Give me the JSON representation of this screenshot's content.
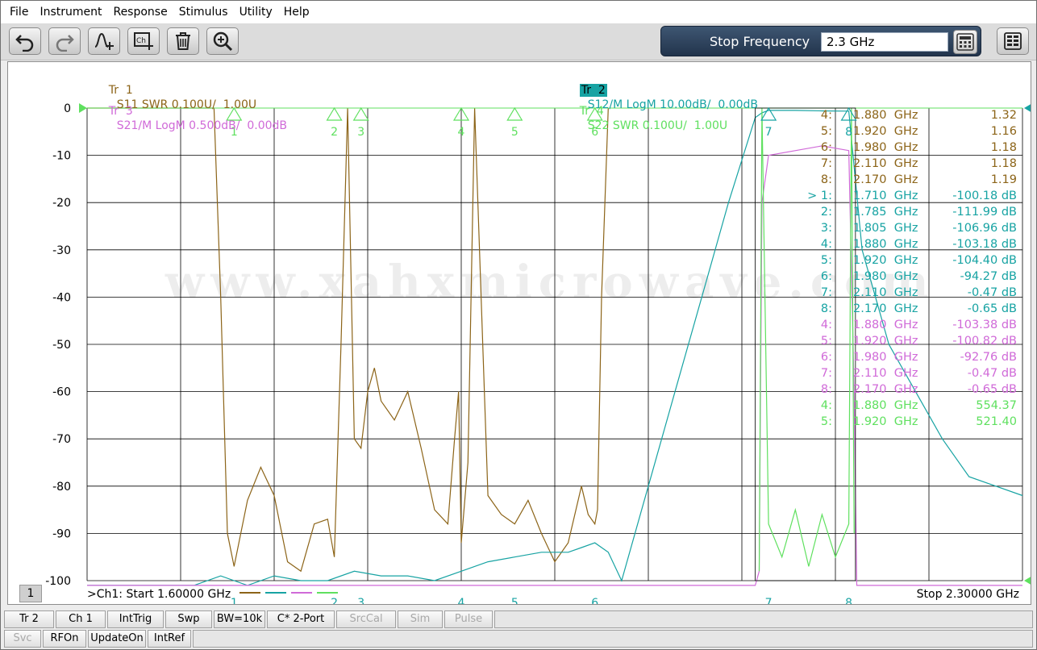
{
  "menu": [
    "File",
    "Instrument",
    "Response",
    "Stimulus",
    "Utility",
    "Help"
  ],
  "toolbar": {
    "icons": [
      "undo-icon",
      "redo-icon",
      "marker-add-icon",
      "channel-add-icon",
      "delete-icon",
      "zoom-icon"
    ],
    "entry_label": "Stop Frequency",
    "entry_value": "2.3 GHz",
    "keypad_icon": "calculator-icon",
    "menu_icon": "hardkey-menu-icon"
  },
  "traces": {
    "tr1": {
      "name": "Tr  1",
      "desc": "S11 SWR 0.100U/  1.00U",
      "color": "#8c6418"
    },
    "tr2": {
      "name": "Tr  2",
      "desc": "S12/M LogM 10.00dB/  0.00dB",
      "color": "#17a3a3"
    },
    "tr3": {
      "name": "Tr  3",
      "desc": "S21/M LogM 0.500dB/  0.00dB",
      "color": "#d06ad8"
    },
    "tr4": {
      "name": "Tr  4",
      "desc": "S22 SWR 0.100U/  1.00U",
      "color": "#5fe05f"
    }
  },
  "y_ticks": [
    "0",
    "-10",
    "-20",
    "-30",
    "-40",
    "-50",
    "-60",
    "-70",
    "-80",
    "-90",
    "-100"
  ],
  "marker_table": [
    {
      "m": "4:",
      "f": "1.880  GHz",
      "v": "1.32",
      "trace": "tr1"
    },
    {
      "m": "5:",
      "f": "1.920  GHz",
      "v": "1.16",
      "trace": "tr1"
    },
    {
      "m": "6:",
      "f": "1.980  GHz",
      "v": "1.18",
      "trace": "tr1"
    },
    {
      "m": "7:",
      "f": "2.110  GHz",
      "v": "1.18",
      "trace": "tr1"
    },
    {
      "m": "8:",
      "f": "2.170  GHz",
      "v": "1.19",
      "trace": "tr1"
    },
    {
      "m": "> 1:",
      "f": "1.710  GHz",
      "v": "-100.18 dB",
      "trace": "tr2"
    },
    {
      "m": "2:",
      "f": "1.785  GHz",
      "v": "-111.99 dB",
      "trace": "tr2"
    },
    {
      "m": "3:",
      "f": "1.805  GHz",
      "v": "-106.96 dB",
      "trace": "tr2"
    },
    {
      "m": "4:",
      "f": "1.880  GHz",
      "v": "-103.18 dB",
      "trace": "tr2"
    },
    {
      "m": "5:",
      "f": "1.920  GHz",
      "v": "-104.40 dB",
      "trace": "tr2"
    },
    {
      "m": "6:",
      "f": "1.980  GHz",
      "v": "-94.27 dB",
      "trace": "tr2"
    },
    {
      "m": "7:",
      "f": "2.110  GHz",
      "v": "-0.47 dB",
      "trace": "tr2"
    },
    {
      "m": "8:",
      "f": "2.170  GHz",
      "v": "-0.65 dB",
      "trace": "tr2"
    },
    {
      "m": "4:",
      "f": "1.880  GHz",
      "v": "-103.38 dB",
      "trace": "tr3"
    },
    {
      "m": "5:",
      "f": "1.920  GHz",
      "v": "-100.82 dB",
      "trace": "tr3"
    },
    {
      "m": "6:",
      "f": "1.980  GHz",
      "v": "-92.76 dB",
      "trace": "tr3"
    },
    {
      "m": "7:",
      "f": "2.110  GHz",
      "v": "-0.47 dB",
      "trace": "tr3"
    },
    {
      "m": "8:",
      "f": "2.170  GHz",
      "v": "-0.65 dB",
      "trace": "tr3"
    },
    {
      "m": "4:",
      "f": "1.880  GHz",
      "v": "554.37",
      "trace": "tr4"
    },
    {
      "m": "5:",
      "f": "1.920  GHz",
      "v": "521.40",
      "trace": "tr4"
    }
  ],
  "watermark": "www.xahxmicrowave.com",
  "channel_number": "1",
  "start_info": ">Ch1:  Start   1.60000 GHz",
  "stop_info": "Stop  2.30000 GHz",
  "status_row1": [
    {
      "label": "Tr 2",
      "enabled": true
    },
    {
      "label": "Ch 1",
      "enabled": true
    },
    {
      "label": "IntTrig",
      "enabled": true
    },
    {
      "label": "Swp",
      "enabled": true
    },
    {
      "label": "BW=10k",
      "enabled": true
    },
    {
      "label": "C* 2-Port",
      "enabled": true
    },
    {
      "label": "SrcCal",
      "enabled": false
    },
    {
      "label": "Sim",
      "enabled": false
    },
    {
      "label": "Pulse",
      "enabled": false
    }
  ],
  "status_row2": [
    {
      "label": "Svc",
      "enabled": false
    },
    {
      "label": "RFOn",
      "enabled": true
    },
    {
      "label": "UpdateOn",
      "enabled": true
    },
    {
      "label": "IntRef",
      "enabled": true
    }
  ],
  "chart_data": {
    "type": "line",
    "x_range_ghz": [
      1.6,
      2.3
    ],
    "ylim": [
      -100,
      0
    ],
    "ytick_step": 10,
    "grid": true,
    "markers_ghz": {
      "1": 1.71,
      "2": 1.785,
      "3": 1.805,
      "4": 1.88,
      "5": 1.92,
      "6": 1.98,
      "7": 2.11,
      "8": 2.17
    },
    "series": [
      {
        "name": "S11 SWR",
        "trace": "tr1",
        "x": [
          1.6,
          1.695,
          1.7,
          1.705,
          1.71,
          1.72,
          1.73,
          1.74,
          1.75,
          1.76,
          1.77,
          1.78,
          1.785,
          1.79,
          1.795,
          1.8,
          1.805,
          1.81,
          1.815,
          1.82,
          1.83,
          1.84,
          1.85,
          1.86,
          1.87,
          1.875,
          1.878,
          1.88,
          1.885,
          1.89,
          1.9,
          1.91,
          1.92,
          1.93,
          1.94,
          1.95,
          1.96,
          1.97,
          1.975,
          1.98,
          1.982,
          1.985,
          1.99
        ],
        "y": [
          0,
          0,
          -40,
          -90,
          -97,
          -83,
          -76,
          -82,
          -96,
          -98,
          -88,
          -87,
          -95,
          -50,
          0,
          -70,
          -72,
          -60,
          -55,
          -62,
          -66,
          -60,
          -72,
          -85,
          -88,
          -70,
          -60,
          -92,
          -75,
          0,
          -82,
          -86,
          -88,
          -83,
          -90,
          -96,
          -92,
          -80,
          -86,
          -88,
          -85,
          -40,
          0
        ]
      },
      {
        "name": "S12 LogM",
        "trace": "tr2",
        "x": [
          1.6,
          1.68,
          1.7,
          1.72,
          1.74,
          1.76,
          1.78,
          1.8,
          1.82,
          1.84,
          1.86,
          1.88,
          1.9,
          1.92,
          1.94,
          1.96,
          1.97,
          1.98,
          1.99,
          2.0,
          2.02,
          2.04,
          2.06,
          2.08,
          2.1,
          2.105,
          2.11,
          2.13,
          2.15,
          2.17,
          2.18,
          2.19,
          2.2,
          2.22,
          2.24,
          2.26,
          2.28,
          2.3
        ],
        "y": [
          -101,
          -101,
          -99,
          -101,
          -99,
          -100,
          -100,
          -98,
          -99,
          -99,
          -100,
          -98,
          -96,
          -95,
          -94,
          -94,
          -93,
          -92,
          -94,
          -100,
          -80,
          -60,
          -40,
          -20,
          -2,
          -1,
          -0.5,
          -0.5,
          -0.6,
          -0.65,
          -30,
          -40,
          -50,
          -60,
          -70,
          -78,
          -80,
          -82
        ]
      },
      {
        "name": "S21 LogM",
        "trace": "tr3",
        "x": [
          1.6,
          2.1,
          2.103,
          2.105,
          2.11,
          2.15,
          2.17,
          2.174,
          2.176,
          2.3
        ],
        "y": [
          -101,
          -101,
          -98,
          -20,
          -10,
          -8,
          -9,
          -60,
          -101,
          -101
        ]
      },
      {
        "name": "S22 SWR",
        "trace": "tr4",
        "x": [
          2.103,
          2.105,
          2.11,
          2.12,
          2.13,
          2.14,
          2.15,
          2.16,
          2.17,
          2.172,
          2.174
        ],
        "y": [
          -98,
          0,
          -88,
          -95,
          -85,
          -97,
          -86,
          -95,
          -88,
          0,
          -90
        ]
      }
    ]
  }
}
